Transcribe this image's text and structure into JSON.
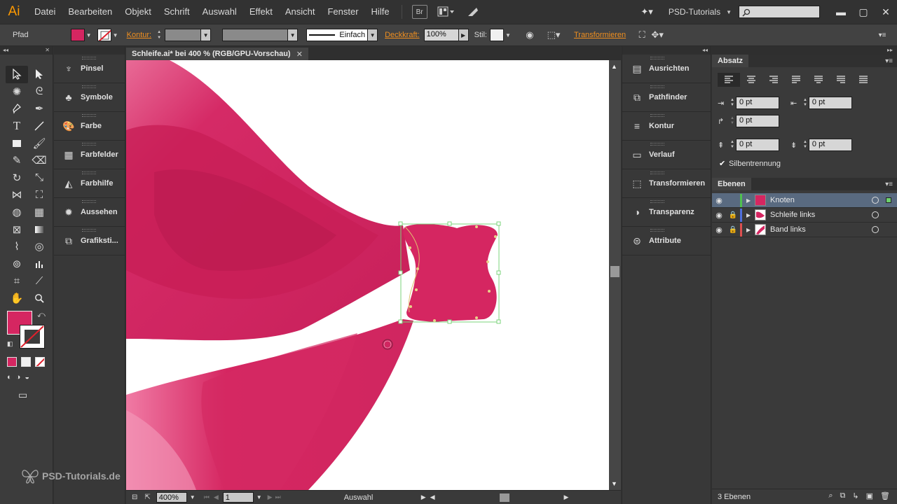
{
  "app": {
    "logo": "Ai"
  },
  "menu": [
    "Datei",
    "Bearbeiten",
    "Objekt",
    "Schrift",
    "Auswahl",
    "Effekt",
    "Ansicht",
    "Fenster",
    "Hilfe"
  ],
  "menubar_icons": {
    "bridge": "Br",
    "arrange": "arrange-documents-icon",
    "gpu": "gpu-performance-icon"
  },
  "workspace": "PSD-Tutorials",
  "search": {
    "placeholder": ""
  },
  "control": {
    "object_type": "Pfad",
    "fill_color": "#d52661",
    "stroke_label": "Kontur:",
    "stroke_profile": "Einfach",
    "opacity_label": "Deckkraft:",
    "opacity_value": "100%",
    "style_label": "Stil:",
    "transform_label": "Transformieren"
  },
  "tool_panel": {
    "fill_color": "#d52661",
    "tools": [
      "selection",
      "direct-selection",
      "magic-wand",
      "lasso",
      "pen",
      "curvature",
      "type",
      "line",
      "rectangle",
      "paintbrush",
      "pencil",
      "eraser",
      "rotate",
      "scale",
      "width",
      "free-transform",
      "shape-builder",
      "perspective-grid",
      "mesh",
      "gradient",
      "eyedropper",
      "blend",
      "symbol-sprayer",
      "column-graph",
      "artboard",
      "slice",
      "hand",
      "zoom"
    ]
  },
  "panels_left": [
    {
      "label": "Pinsel",
      "icon": "brush-icon"
    },
    {
      "label": "Symbole",
      "icon": "club-icon"
    },
    {
      "label": "Farbe",
      "icon": "palette-icon"
    },
    {
      "label": "Farbfelder",
      "icon": "grid-icon"
    },
    {
      "label": "Farbhilfe",
      "icon": "color-guide-icon"
    },
    {
      "label": "Aussehen",
      "icon": "sun-icon"
    },
    {
      "label": "Grafiksti...",
      "icon": "graphic-styles-icon"
    }
  ],
  "document": {
    "tab_title": "Schleife.ai* bei 400 % (RGB/GPU-Vorschau)",
    "zoom": "400%",
    "artboard": "1",
    "status": "Auswahl"
  },
  "panels_right": [
    {
      "label": "Ausrichten",
      "icon": "align-icon"
    },
    {
      "label": "Pathfinder",
      "icon": "pathfinder-icon"
    },
    {
      "label": "Kontur",
      "icon": "stroke-icon"
    },
    {
      "label": "Verlauf",
      "icon": "gradient-icon"
    },
    {
      "label": "Transformieren",
      "icon": "transform-icon"
    },
    {
      "label": "Transparenz",
      "icon": "transparency-icon"
    },
    {
      "label": "Attribute",
      "icon": "attributes-icon"
    }
  ],
  "absatz": {
    "title": "Absatz",
    "left_indent": "0 pt",
    "right_indent": "0 pt",
    "first_line_indent": "0 pt",
    "space_before": "0 pt",
    "space_after": "0 pt",
    "hyphenation_label": "Silbentrennung",
    "hyphenation_checked": true
  },
  "ebenen": {
    "title": "Ebenen",
    "layers": [
      {
        "name": "Knoten",
        "color": "#4fc04f",
        "locked": false,
        "selected": true
      },
      {
        "name": "Schleife links",
        "color": "#4f6fdc",
        "locked": true,
        "selected": false
      },
      {
        "name": "Band links",
        "color": "#dc4f4f",
        "locked": true,
        "selected": false
      }
    ],
    "count_label": "3 Ebenen"
  },
  "watermark": "PSD-Tutorials.de"
}
